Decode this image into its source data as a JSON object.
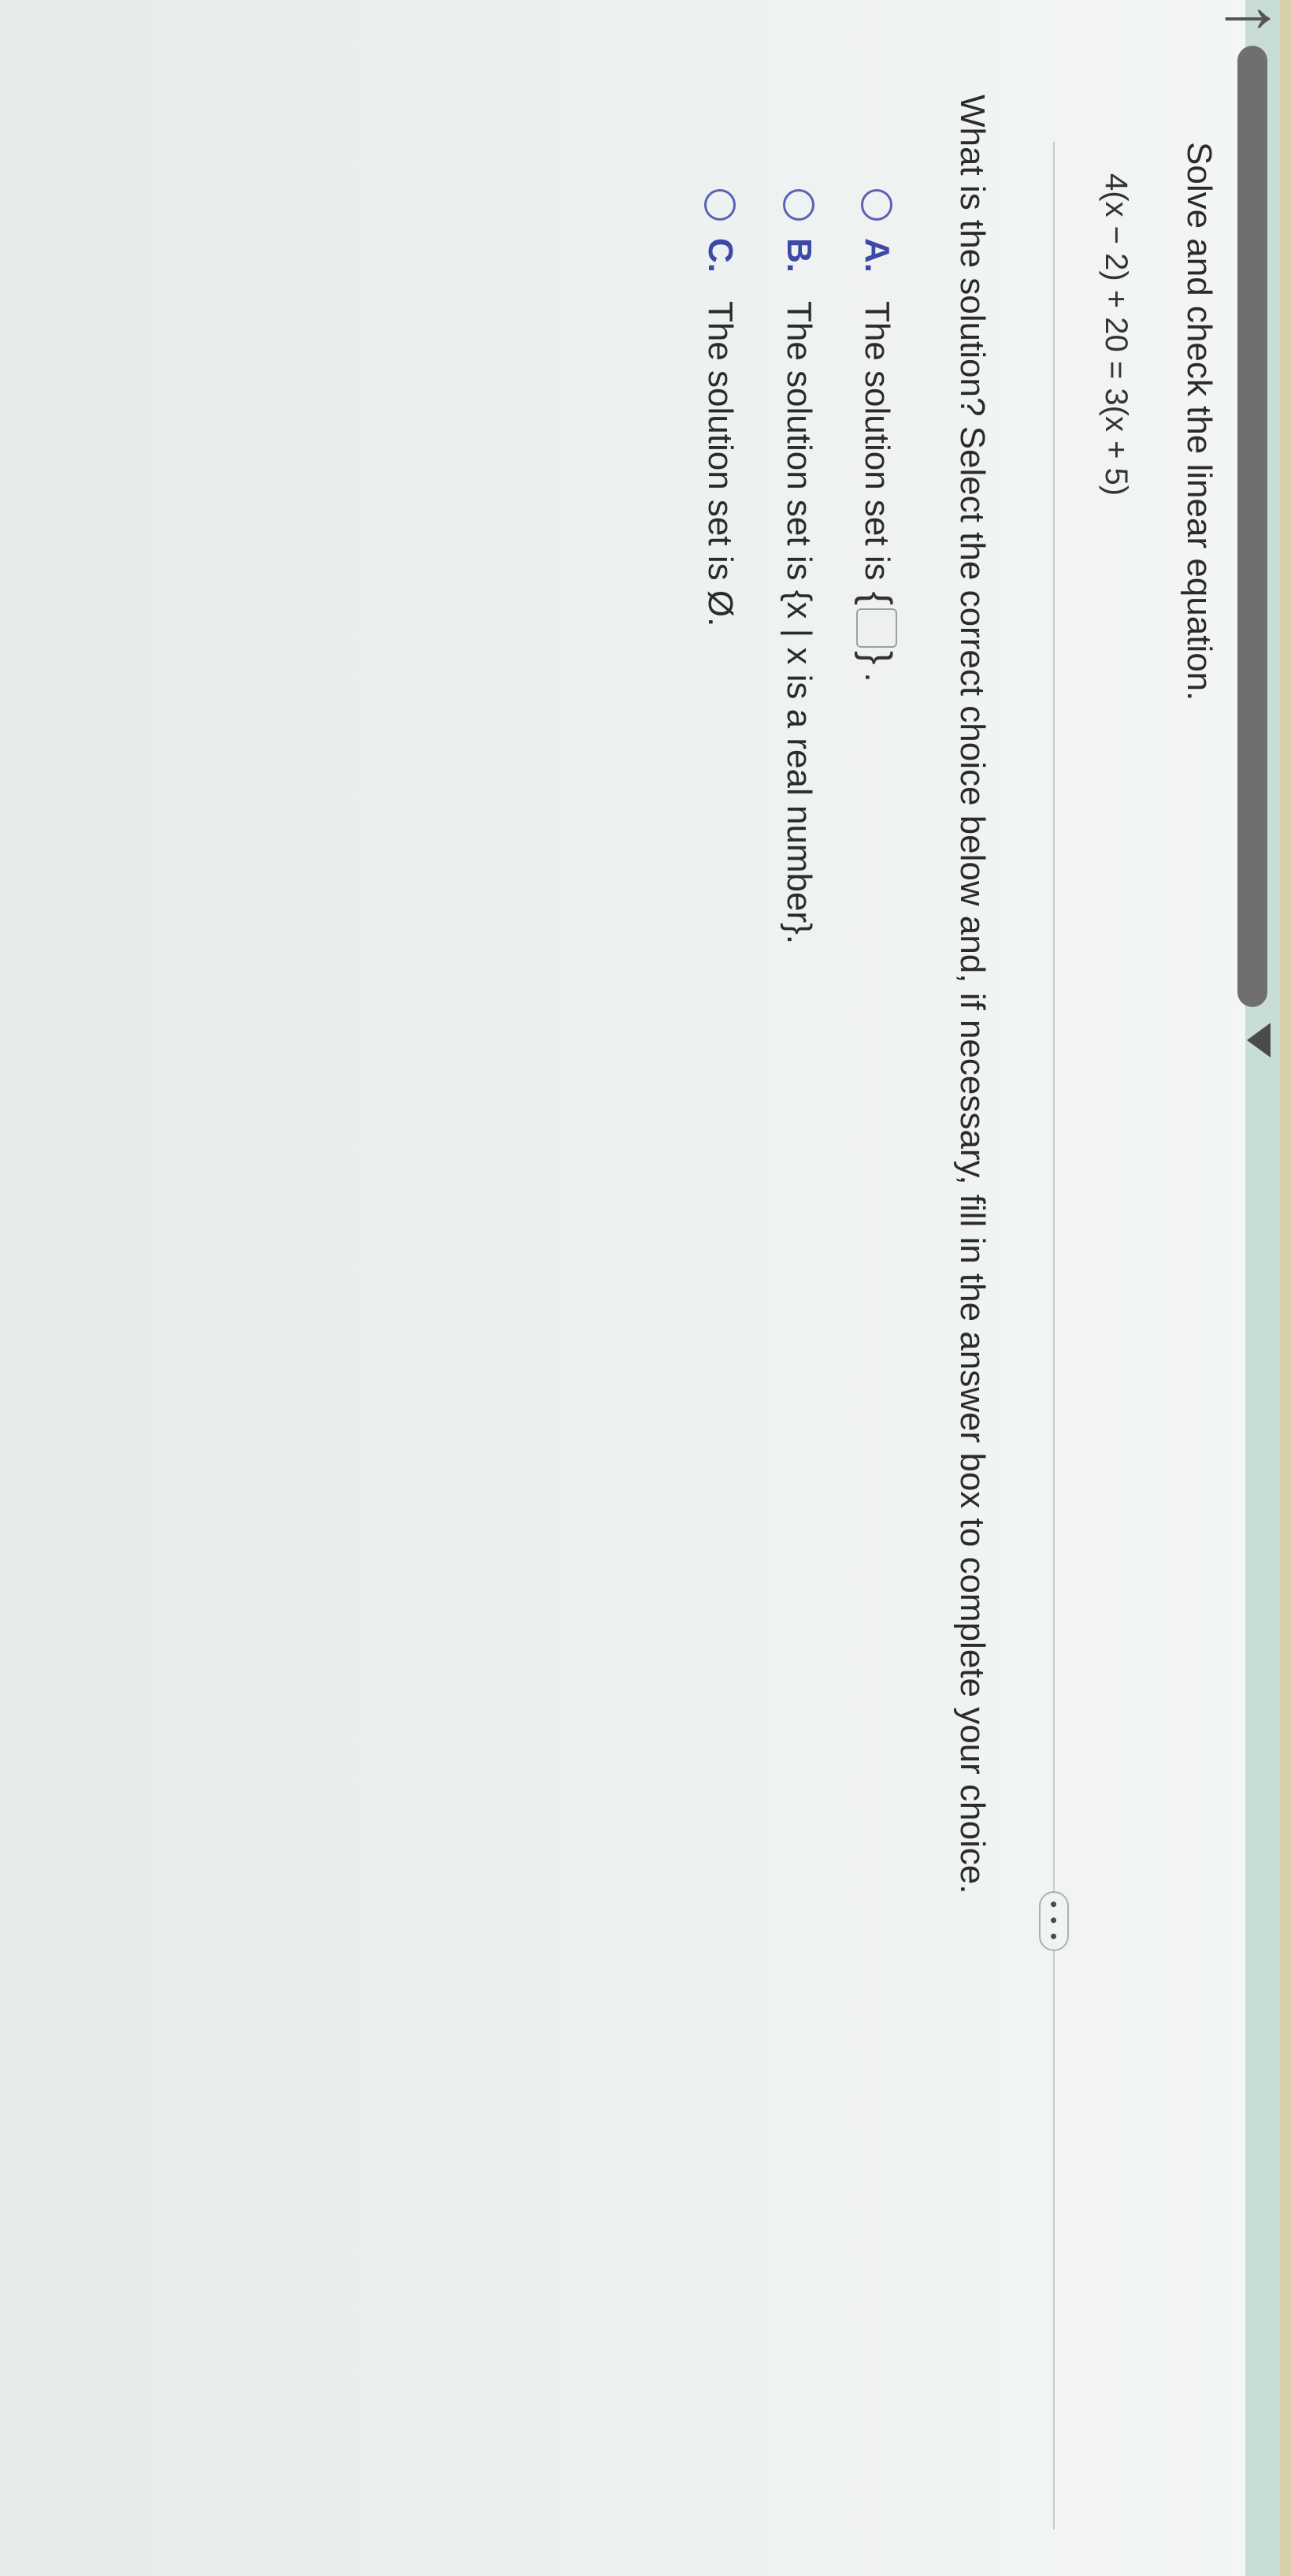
{
  "nav": {
    "back_glyph": "←",
    "more_label": "• • •"
  },
  "question": {
    "prompt": "Solve and check the linear equation.",
    "equation": "4(x − 2) + 20 = 3(x + 5)",
    "instruction": "What is the solution? Select the correct choice below and, if necessary, fill in the answer box to complete your choice."
  },
  "choices": [
    {
      "letter": "A.",
      "text": "The solution set is",
      "suffix": ".",
      "has_answer_box": true,
      "answer_value": ""
    },
    {
      "letter": "B.",
      "text": "The solution set is {x | x is a real number}."
    },
    {
      "letter": "C.",
      "text": "The solution set is Ø."
    }
  ],
  "colors": {
    "accent": "#3d48a8",
    "radio_border": "#5b62b4",
    "progress": "#6f6f6f"
  }
}
